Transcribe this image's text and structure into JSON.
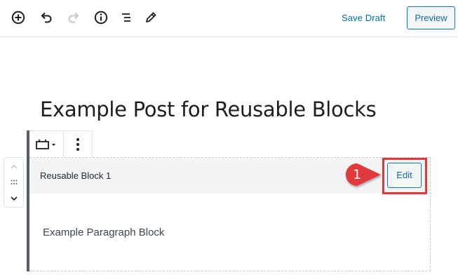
{
  "toolbar": {
    "icons": [
      "add-block-icon",
      "undo-icon",
      "redo-icon",
      "info-icon",
      "outline-icon",
      "pencil-icon"
    ],
    "save_draft_label": "Save Draft",
    "preview_label": "Preview"
  },
  "post": {
    "title": "Example Post for Reusable Blocks"
  },
  "block": {
    "mover_icons": [
      "chevron-up-icon",
      "drag-handle-icon",
      "chevron-down-icon"
    ],
    "toolbar_icons": [
      "block-switcher-icon",
      "more-options-icon"
    ],
    "reusable_name": "Reusable Block 1",
    "edit_label": "Edit",
    "paragraph_text": "Example Paragraph Block"
  },
  "annotation": {
    "step_number": "1",
    "color": "#e0383b"
  },
  "colors": {
    "accent": "#0073aa",
    "block_rule": "#555d66",
    "header_bg": "#f3f4f5"
  }
}
